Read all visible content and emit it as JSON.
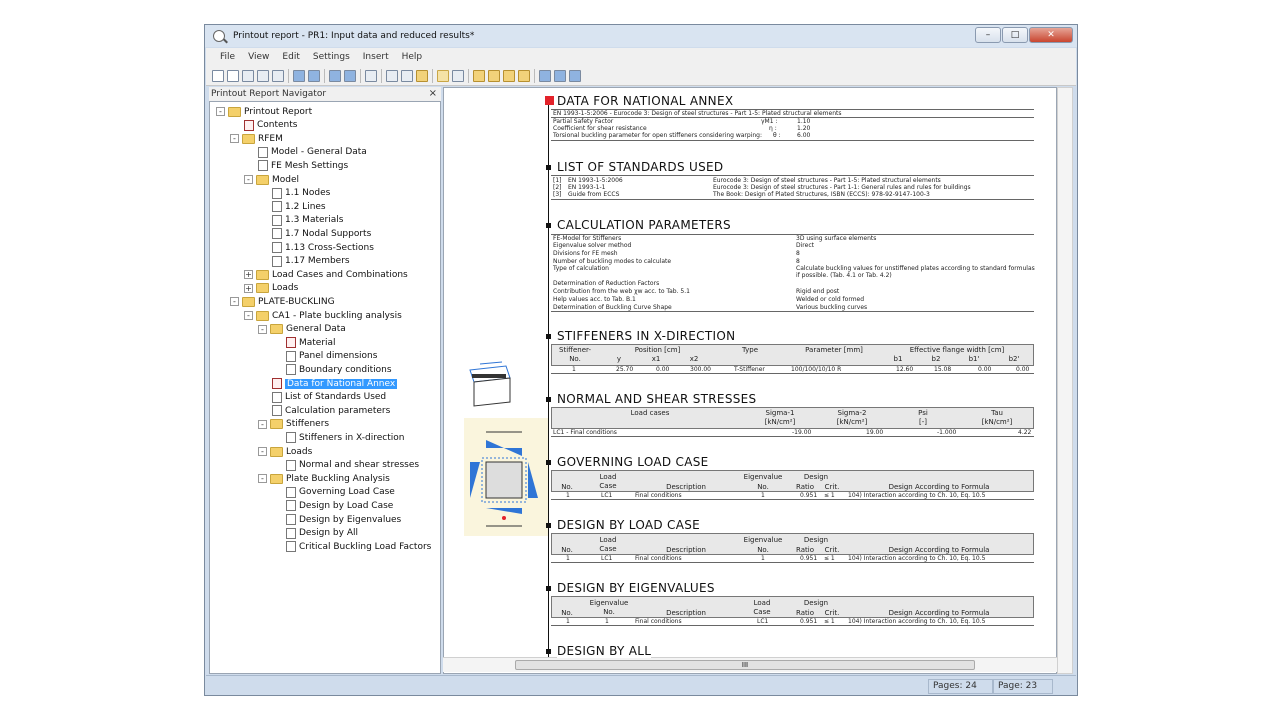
{
  "window": {
    "title": "Printout report - PR1: Input data and reduced results*",
    "btn_minimize": "–",
    "btn_maximize": "□",
    "btn_close": "✕"
  },
  "menu": [
    "File",
    "View",
    "Edit",
    "Settings",
    "Insert",
    "Help"
  ],
  "navigator": {
    "header": "Printout Report Navigator",
    "close": "×",
    "nodes": [
      {
        "label": "Printout Report",
        "icon": "folder-icon",
        "level": 0,
        "expander": "-"
      },
      {
        "label": "Contents",
        "icon": "page-red-icon",
        "level": 1
      },
      {
        "label": "RFEM",
        "icon": "folder-icon",
        "level": 1,
        "expander": "-"
      },
      {
        "label": "Model - General Data",
        "icon": "page-icon",
        "level": 2
      },
      {
        "label": "FE Mesh Settings",
        "icon": "page-icon",
        "level": 2
      },
      {
        "label": "Model",
        "icon": "folder-icon",
        "level": 2,
        "expander": "-"
      },
      {
        "label": "1.1 Nodes",
        "icon": "page-icon",
        "level": 3
      },
      {
        "label": "1.2 Lines",
        "icon": "page-icon",
        "level": 3
      },
      {
        "label": "1.3 Materials",
        "icon": "page-icon",
        "level": 3
      },
      {
        "label": "1.7 Nodal Supports",
        "icon": "page-icon",
        "level": 3
      },
      {
        "label": "1.13 Cross-Sections",
        "icon": "page-icon",
        "level": 3
      },
      {
        "label": "1.17 Members",
        "icon": "page-icon",
        "level": 3
      },
      {
        "label": "Load Cases and Combinations",
        "icon": "folder-icon",
        "level": 2,
        "expander": "+"
      },
      {
        "label": "Loads",
        "icon": "folder-icon",
        "level": 2,
        "expander": "+"
      },
      {
        "label": "PLATE-BUCKLING",
        "icon": "folder-icon",
        "level": 1,
        "expander": "-"
      },
      {
        "label": "CA1 - Plate buckling analysis",
        "icon": "folder-icon",
        "level": 2,
        "expander": "-"
      },
      {
        "label": "General Data",
        "icon": "folder-icon",
        "level": 3,
        "expander": "-"
      },
      {
        "label": "Material",
        "icon": "page-red-icon",
        "level": 4
      },
      {
        "label": "Panel dimensions",
        "icon": "page-icon",
        "level": 4
      },
      {
        "label": "Boundary conditions",
        "icon": "page-icon",
        "level": 4
      },
      {
        "label": "Data for National Annex",
        "icon": "page-red-icon",
        "level": 3,
        "selected": true
      },
      {
        "label": "List of Standards Used",
        "icon": "page-icon",
        "level": 3
      },
      {
        "label": "Calculation parameters",
        "icon": "page-icon",
        "level": 3
      },
      {
        "label": "Stiffeners",
        "icon": "folder-icon",
        "level": 3,
        "expander": "-"
      },
      {
        "label": "Stiffeners in X-direction",
        "icon": "page-icon",
        "level": 4
      },
      {
        "label": "Loads",
        "icon": "folder-icon",
        "level": 3,
        "expander": "-"
      },
      {
        "label": "Normal and shear stresses",
        "icon": "page-icon",
        "level": 4
      },
      {
        "label": "Plate Buckling Analysis",
        "icon": "folder-icon",
        "level": 3,
        "expander": "-"
      },
      {
        "label": "Governing Load Case",
        "icon": "page-icon",
        "level": 4
      },
      {
        "label": "Design by Load Case",
        "icon": "page-icon",
        "level": 4
      },
      {
        "label": "Design by Eigenvalues",
        "icon": "page-icon",
        "level": 4
      },
      {
        "label": "Design by All",
        "icon": "page-icon",
        "level": 4
      },
      {
        "label": "Critical Buckling Load Factors",
        "icon": "page-icon",
        "level": 4
      }
    ]
  },
  "report": {
    "national_annex": {
      "heading": "DATA FOR NATIONAL ANNEX",
      "standard": "EN 1993-1-5:2006 - Eurocode 3: Design of steel structures - Part 1-5: Plated structural elements",
      "rows": [
        {
          "label": "Partial Safety Factor",
          "sym": "γM1 :",
          "val": "1.10"
        },
        {
          "label": "Coefficient for shear resistance",
          "sym": "η :",
          "val": "1.20"
        },
        {
          "label": "Torsional buckling parameter for open stiffeners considering warping:",
          "sym": "θ :",
          "val": "6.00"
        }
      ]
    },
    "standards": {
      "heading": "LIST OF STANDARDS USED",
      "rows": [
        {
          "no": "[1]",
          "code": "EN 1993-1-5:2006",
          "desc": "Eurocode 3: Design of steel structures - Part 1-5: Plated structural elements"
        },
        {
          "no": "[2]",
          "code": "EN 1993-1-1",
          "desc": "Eurocode 3: Design of steel structures - Part 1-1: General rules and rules for buildings"
        },
        {
          "no": "[3]",
          "code": "Guide from ECCS",
          "desc": "The Book: Design of Plated Structures, ISBN (ECCS): 978-92-9147-100-3"
        }
      ]
    },
    "calc": {
      "heading": "CALCULATION PARAMETERS",
      "rows": [
        {
          "label": "FE-Model for Stiffeners",
          "val": "3D using surface elements"
        },
        {
          "label": "Eigenvalue solver method",
          "val": "Direct"
        },
        {
          "label": "Divisions for FE mesh",
          "val": "8"
        },
        {
          "label": "Number of buckling modes to calculate",
          "val": "8"
        },
        {
          "label": "Type of calculation",
          "val": "Calculate buckling values for unstiffened plates according to standard formulas"
        },
        {
          "label": "",
          "val": "if possible. (Tab. 4.1 or Tab. 4.2)"
        },
        {
          "label": "Determination of Reduction Factors",
          "val": ""
        },
        {
          "label": "Contribution from the web χw acc. to Tab. 5.1",
          "val": "Rigid end post"
        },
        {
          "label": "Help values acc. to Tab. B.1",
          "val": "Welded or cold formed"
        },
        {
          "label": "Determination of Buckling Curve Shape",
          "val": "Various buckling curves"
        }
      ]
    },
    "stiffeners": {
      "heading": "STIFFENERS IN X-DIRECTION",
      "h_stiffener": "Stiffener-",
      "h_no": "No.",
      "h_position": "Position [cm]",
      "h_y": "y",
      "h_x1": "x1",
      "h_x2": "x2",
      "h_type": "Type",
      "h_parameter": "Parameter [mm]",
      "h_eff": "Effective flange width [cm]",
      "h_b1": "b1",
      "h_b2": "b2",
      "h_b1p": "b1'",
      "h_b2p": "b2'",
      "row": {
        "no": "1",
        "y": "25.70",
        "x1": "0.00",
        "x2": "300.00",
        "type": "T-Stiffener",
        "param": "100/100/10/10 R",
        "b1": "12.60",
        "b2": "15.08",
        "b1p": "0.00",
        "b2p": "0.00"
      }
    },
    "stresses": {
      "heading": "NORMAL AND SHEAR STRESSES",
      "h_lc": "Load cases",
      "h_s1": "Sigma-1",
      "h_s2": "Sigma-2",
      "h_psi": "Psi",
      "h_tau": "Tau",
      "u_s1": "[kN/cm²]",
      "u_s2": "[kN/cm²]",
      "u_psi": "[-]",
      "u_tau": "[kN/cm²]",
      "row": {
        "lc": "LC1 - Final conditions",
        "s1": "-19.00",
        "s2": "19.00",
        "psi": "-1.000",
        "tau": "4.22"
      }
    },
    "governing": {
      "heading": "GOVERNING LOAD CASE",
      "h_no": "No.",
      "h_load": "Load",
      "h_case": "Case",
      "h_desc": "Description",
      "h_eig": "Eigenvalue",
      "h_eigno": "No.",
      "h_design": "Design",
      "h_ratio": "Ratio",
      "h_crit": "Crit.",
      "h_formula": "Design According to Formula",
      "row": {
        "no": "1",
        "lc": "LC1",
        "desc": "Final conditions",
        "eig": "1",
        "ratio": "0.951",
        "crit": "≤ 1",
        "formula": "104) Interaction according to Ch. 10, Eq. 10.5"
      }
    },
    "by_lc": {
      "heading": "DESIGN BY LOAD CASE",
      "h_no": "No.",
      "h_load": "Load",
      "h_case": "Case",
      "h_desc": "Description",
      "h_eig": "Eigenvalue",
      "h_eigno": "No.",
      "h_design": "Design",
      "h_ratio": "Ratio",
      "h_crit": "Crit.",
      "h_formula": "Design According to Formula",
      "row": {
        "no": "1",
        "lc": "LC1",
        "desc": "Final conditions",
        "eig": "1",
        "ratio": "0.951",
        "crit": "≤ 1",
        "formula": "104) Interaction according to Ch. 10, Eq. 10.5"
      }
    },
    "by_eig": {
      "heading": "DESIGN BY EIGENVALUES",
      "h_no": "No.",
      "h_eig": "Eigenvalue",
      "h_eigno": "No.",
      "h_desc": "Description",
      "h_load": "Load",
      "h_case": "Case",
      "h_design": "Design",
      "h_ratio": "Ratio",
      "h_crit": "Crit.",
      "h_formula": "Design According to Formula",
      "row": {
        "no": "1",
        "eig": "1",
        "desc": "Final conditions",
        "lc": "LC1",
        "ratio": "0.951",
        "crit": "≤ 1",
        "formula": "104) Interaction according to Ch. 10, Eq. 10.5"
      }
    },
    "by_all": {
      "heading": "DESIGN BY ALL"
    }
  },
  "hscroll_thumb": "III",
  "status": {
    "pages": "Pages: 24",
    "page": "Page: 23"
  }
}
